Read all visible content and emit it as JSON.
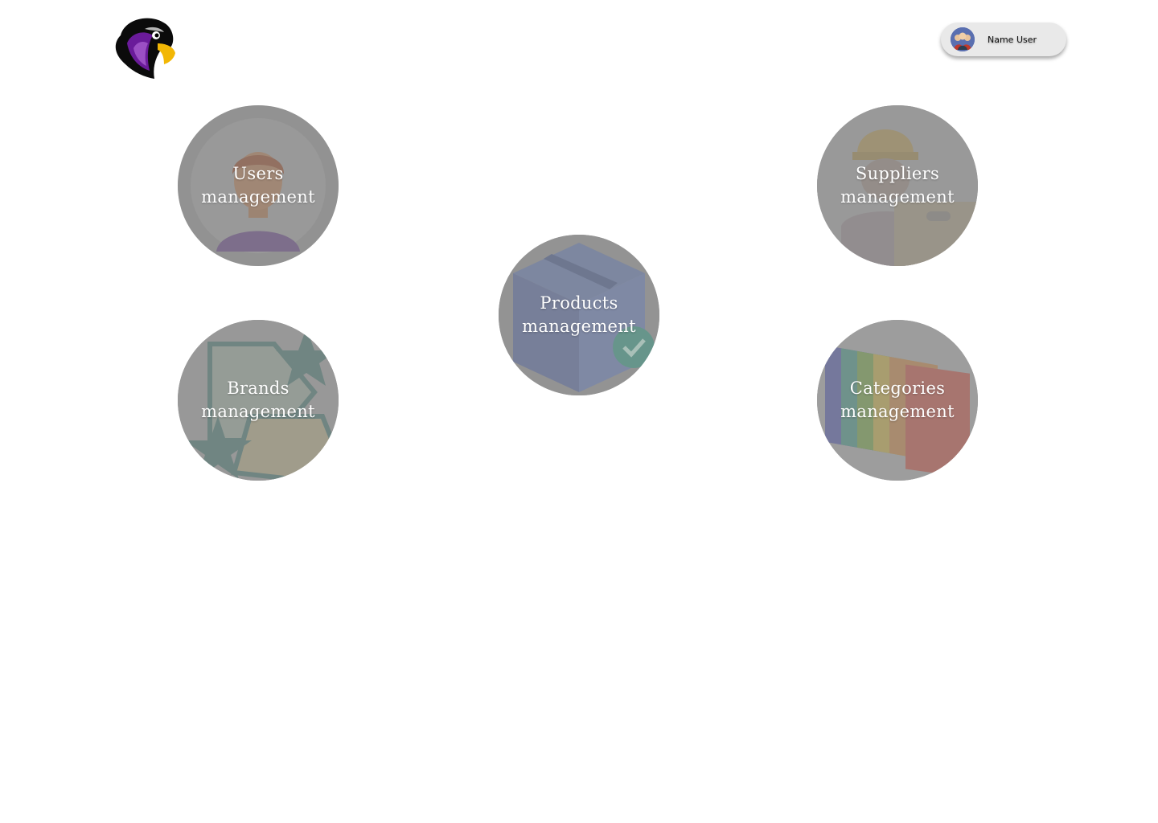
{
  "header": {
    "logo_icon": "eagle-head-logo",
    "user": {
      "name": "Name User",
      "avatar_icon": "users-group-avatar"
    }
  },
  "tiles": [
    {
      "line1": "Users",
      "line2": "management",
      "icon": "person-icon"
    },
    {
      "line1": "Suppliers",
      "line2": "management",
      "icon": "worker-with-box-icon"
    },
    {
      "line1": "Products",
      "line2": "management",
      "icon": "box-check-icon"
    },
    {
      "line1": "Brands",
      "line2": "management",
      "icon": "brand-tags-icon"
    },
    {
      "line1": "Categories",
      "line2": "management",
      "icon": "folders-icon"
    }
  ],
  "colors": {
    "tile_overlay": "#8c8c8c",
    "chip_background": "#e9e9e9",
    "logo_purple": "#6a1b9a",
    "logo_beak": "#f2b705"
  }
}
